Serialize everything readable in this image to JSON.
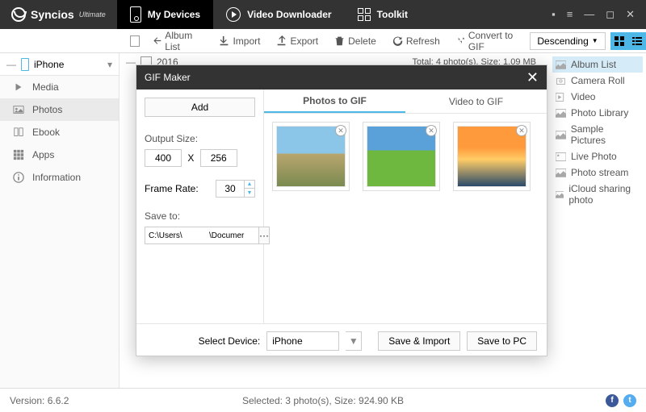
{
  "app": {
    "name": "Syncios",
    "edition": "Ultimate"
  },
  "topTabs": [
    {
      "label": "My Devices",
      "active": true
    },
    {
      "label": "Video Downloader"
    },
    {
      "label": "Toolkit"
    }
  ],
  "device": {
    "name": "iPhone"
  },
  "sidebar": [
    {
      "label": "Media",
      "icon": "media"
    },
    {
      "label": "Photos",
      "icon": "photos",
      "active": true
    },
    {
      "label": "Ebook",
      "icon": "ebook"
    },
    {
      "label": "Apps",
      "icon": "apps"
    },
    {
      "label": "Information",
      "icon": "info"
    }
  ],
  "toolbar": {
    "albumList": "Album List",
    "import": "Import",
    "export": "Export",
    "delete": "Delete",
    "refresh": "Refresh",
    "convertGif": "Convert to GIF",
    "sort": "Descending"
  },
  "yearGroup": {
    "year": "2016",
    "meta": "Total: 4 photo(s), Size: 1.09 MB"
  },
  "albums": [
    "Album List",
    "Camera Roll",
    "Video",
    "Photo Library",
    "Sample Pictures",
    "Live Photo",
    "Photo stream",
    "iCloud sharing photo"
  ],
  "modal": {
    "title": "GIF Maker",
    "add": "Add",
    "tabs": [
      "Photos to GIF",
      "Video to GIF"
    ],
    "outputSizeLabel": "Output Size:",
    "width": "400",
    "x": "X",
    "height": "256",
    "frameRateLabel": "Frame Rate:",
    "frameRate": "30",
    "saveToLabel": "Save to:",
    "savePath": "C:\\Users\\            \\Documer",
    "browse": "···",
    "selectDeviceLabel": "Select Device:",
    "selectedDevice": "iPhone",
    "saveImport": "Save & Import",
    "savePC": "Save to PC"
  },
  "status": {
    "version": "Version: 6.6.2",
    "selected": "Selected: 3 photo(s), Size: 924.90 KB"
  }
}
